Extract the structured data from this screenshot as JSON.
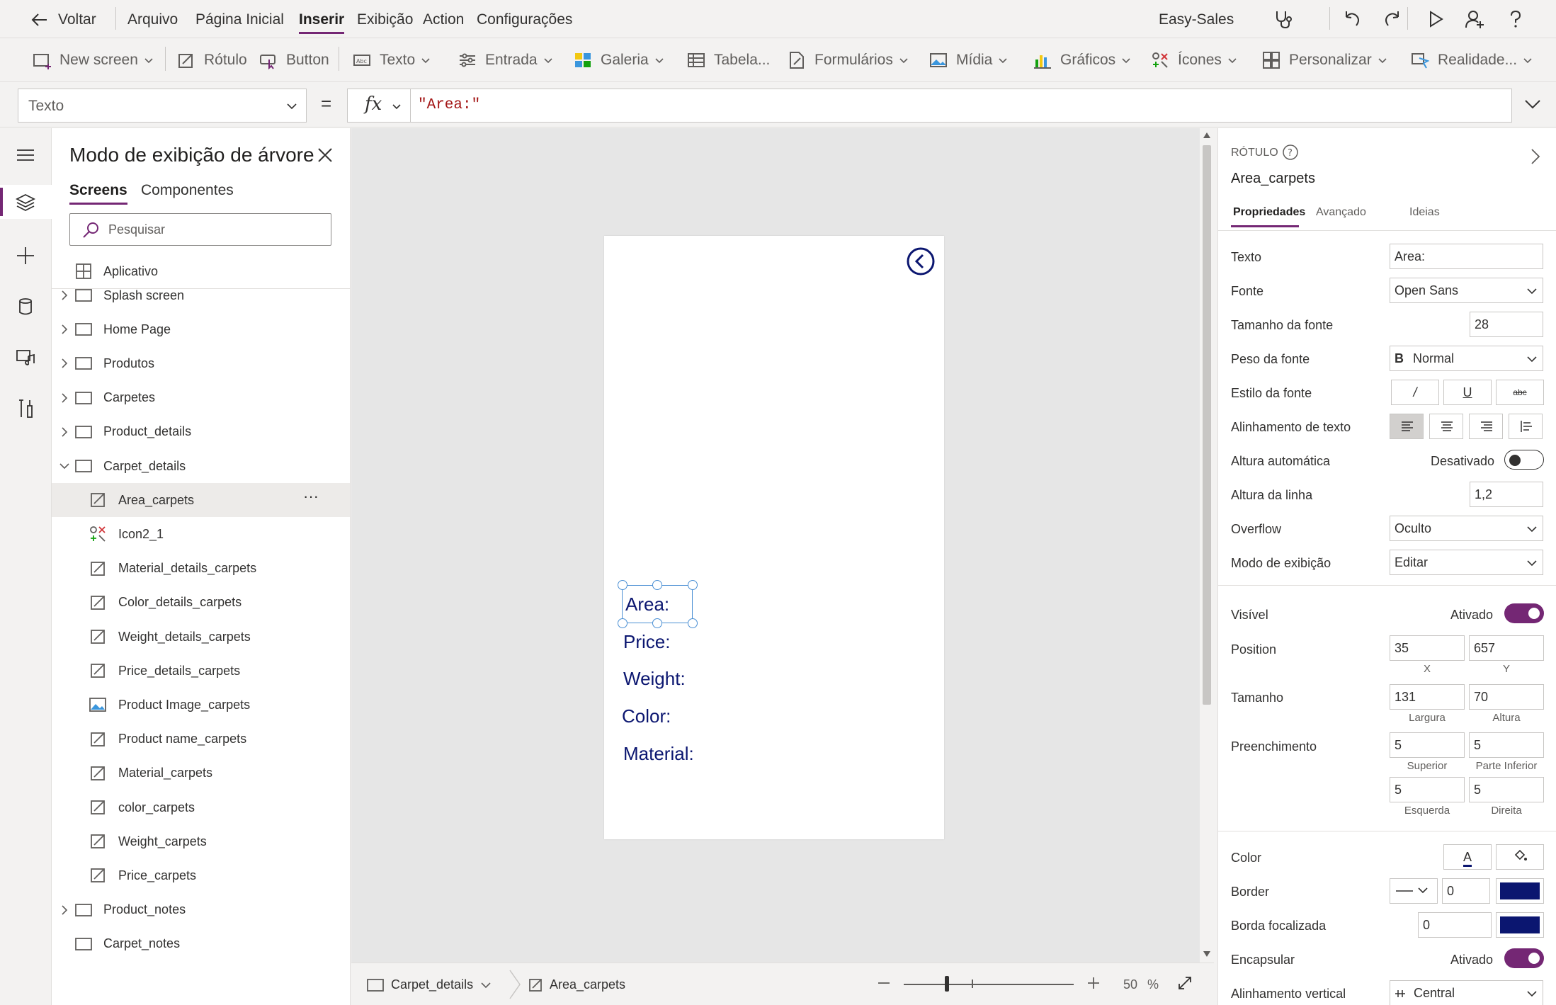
{
  "menubar": {
    "back_label": "Voltar",
    "items": [
      "Arquivo",
      "Página Inicial",
      "Inserir",
      "Exibição",
      "Action",
      "Configurações"
    ],
    "active": "Inserir",
    "app_name": "Easy-Sales"
  },
  "ribbon": {
    "items": [
      {
        "label": "New screen",
        "icon": "new-screen-icon"
      },
      {
        "label": "Rótulo",
        "icon": "label-icon"
      },
      {
        "label": "Button",
        "icon": "button-icon"
      },
      {
        "label": "Texto",
        "icon": "text-icon"
      },
      {
        "label": "Entrada",
        "icon": "input-icon"
      },
      {
        "label": "Galeria",
        "icon": "gallery-icon"
      },
      {
        "label": "Tabela...",
        "icon": "table-icon"
      },
      {
        "label": "Formulários",
        "icon": "forms-icon"
      },
      {
        "label": "Mídia",
        "icon": "media-icon"
      },
      {
        "label": "Gráficos",
        "icon": "charts-icon"
      },
      {
        "label": "Ícones",
        "icon": "icons-icon"
      },
      {
        "label": "Personalizar",
        "icon": "custom-icon"
      },
      {
        "label": "Realidade...",
        "icon": "reality-icon"
      }
    ]
  },
  "formula": {
    "property": "Texto",
    "equals": "=",
    "fx": "fx",
    "value": "\"Area:\""
  },
  "tree": {
    "title": "Modo de exibição de árvore",
    "tabs": [
      "Screens",
      "Componentes"
    ],
    "search_placeholder": "Pesquisar",
    "app_label": "Aplicativo",
    "items": [
      {
        "label": "Splash screen",
        "type": "screen",
        "expand": "collapsed"
      },
      {
        "label": "Home Page",
        "type": "screen",
        "expand": "collapsed"
      },
      {
        "label": "Produtos",
        "type": "screen",
        "expand": "collapsed"
      },
      {
        "label": "Carpetes",
        "type": "screen",
        "expand": "collapsed"
      },
      {
        "label": "Product_details",
        "type": "screen",
        "expand": "collapsed"
      },
      {
        "label": "Carpet_details",
        "type": "screen",
        "expand": "expanded"
      },
      {
        "label": "Area_carpets",
        "type": "label",
        "selected": true
      },
      {
        "label": "Icon2_1",
        "type": "icon"
      },
      {
        "label": "Material_details_carpets",
        "type": "label"
      },
      {
        "label": "Color_details_carpets",
        "type": "label"
      },
      {
        "label": "Weight_details_carpets",
        "type": "label"
      },
      {
        "label": "Price_details_carpets",
        "type": "label"
      },
      {
        "label": "Product Image_carpets",
        "type": "image"
      },
      {
        "label": "Product name_carpets",
        "type": "label"
      },
      {
        "label": "Material_carpets",
        "type": "label"
      },
      {
        "label": "color_carpets",
        "type": "label"
      },
      {
        "label": "Weight_carpets",
        "type": "label"
      },
      {
        "label": "Price_carpets",
        "type": "label"
      },
      {
        "label": "Product_notes",
        "type": "screen",
        "expand": "collapsed"
      },
      {
        "label": "Carpet_notes",
        "type": "screen",
        "expand": "none"
      }
    ],
    "more_label": "···"
  },
  "canvas": {
    "labels": [
      "Area:",
      "Price:",
      "Weight:",
      "Color:",
      "Material:"
    ],
    "text_color": "#0b1670"
  },
  "bottombar": {
    "screen": "Carpet_details",
    "control": "Area_carpets",
    "zoom_value": "50",
    "zoom_unit": "%"
  },
  "panel": {
    "type_label": "RÓTULO",
    "control_name": "Area_carpets",
    "tabs": [
      "Propriedades",
      "Avançado",
      "Ideias"
    ],
    "props": {
      "texto_label": "Texto",
      "texto_value": "Area:",
      "fonte_label": "Fonte",
      "fonte_value": "Open Sans",
      "tamanho_fonte_label": "Tamanho da fonte",
      "tamanho_fonte_value": "28",
      "peso_label": "Peso da fonte",
      "peso_prefix": "B",
      "peso_value": "Normal",
      "estilo_label": "Estilo da fonte",
      "estilo_buttons": [
        "/",
        "U",
        "abc"
      ],
      "alinhamento_label": "Alinhamento de texto",
      "altura_auto_label": "Altura automática",
      "altura_auto_value": "Desativado",
      "altura_linha_label": "Altura da linha",
      "altura_linha_value": "1,2",
      "overflow_label": "Overflow",
      "overflow_value": "Oculto",
      "modo_label": "Modo de exibição",
      "modo_value": "Editar",
      "visivel_label": "Visível",
      "visivel_value": "Ativado",
      "position_label": "Position",
      "pos_x": "35",
      "pos_y": "657",
      "x_label": "X",
      "y_label": "Y",
      "tamanho_label": "Tamanho",
      "largura": "131",
      "altura": "70",
      "largura_label": "Largura",
      "altura_label": "Altura",
      "preenchimento_label": "Preenchimento",
      "superior": "5",
      "inferior": "5",
      "esquerda": "5",
      "direita": "5",
      "superior_label": "Superior",
      "inferior_label": "Parte Inferior",
      "esquerda_label": "Esquerda",
      "direita_label": "Direita",
      "color_label": "Color",
      "color_letter": "A",
      "border_label": "Border",
      "border_value": "0",
      "border_color": "#0b1670",
      "borda_foc_label": "Borda focalizada",
      "borda_foc_value": "0",
      "encapsular_label": "Encapsular",
      "encapsular_value": "Ativado",
      "alinh_vert_label": "Alinhamento vertical",
      "alinh_vert_value": "Central"
    },
    "accent": "#742774"
  }
}
